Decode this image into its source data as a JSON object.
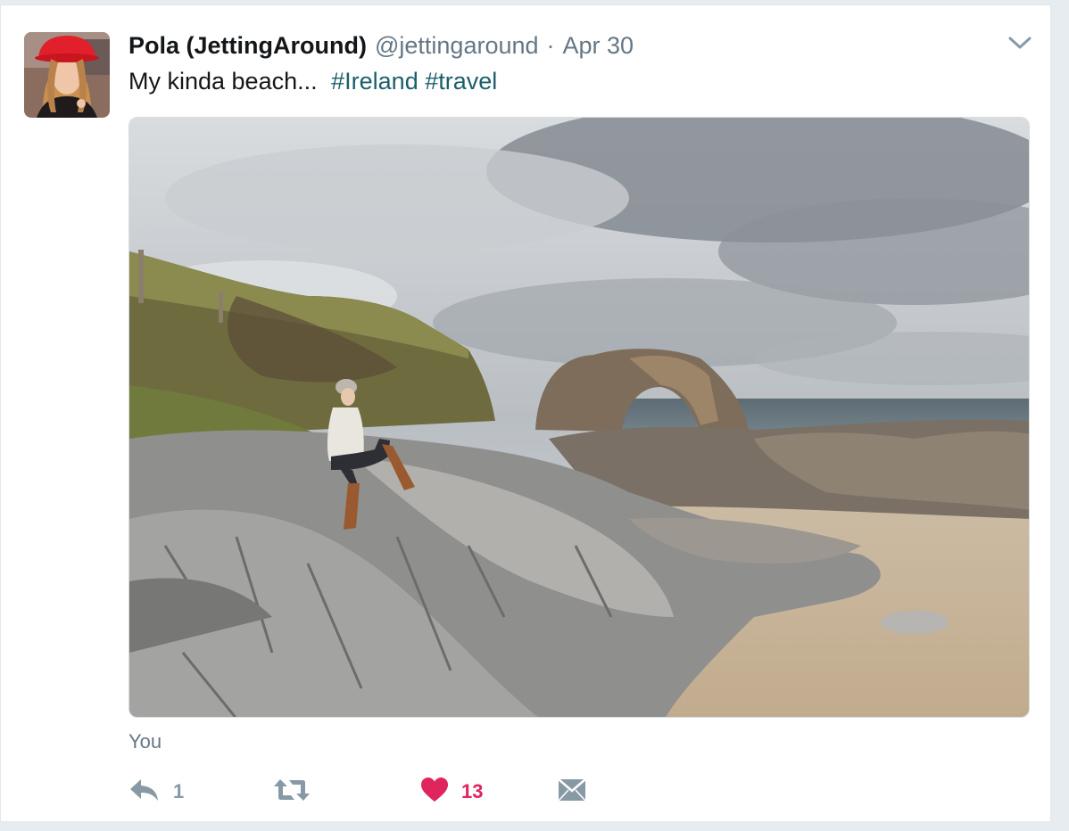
{
  "tweet": {
    "fullname": "Pola (JettingAround)",
    "handle": "@jettingaround",
    "separator": "·",
    "timestamp": "Apr 30",
    "text": "My kinda beach...",
    "hashtags": [
      "#Ireland",
      "#travel"
    ],
    "media_tagged": "You",
    "actions": {
      "reply_count": "1",
      "retweet_count": "",
      "like_count": "13"
    },
    "icons": {
      "caret": "chevron-down-icon",
      "reply": "reply-icon",
      "retweet": "retweet-icon",
      "like": "heart-icon",
      "dm": "envelope-icon"
    },
    "colors": {
      "hashtag": "#1b5f6b",
      "like_active": "#e0245e",
      "muted": "#657786"
    }
  }
}
